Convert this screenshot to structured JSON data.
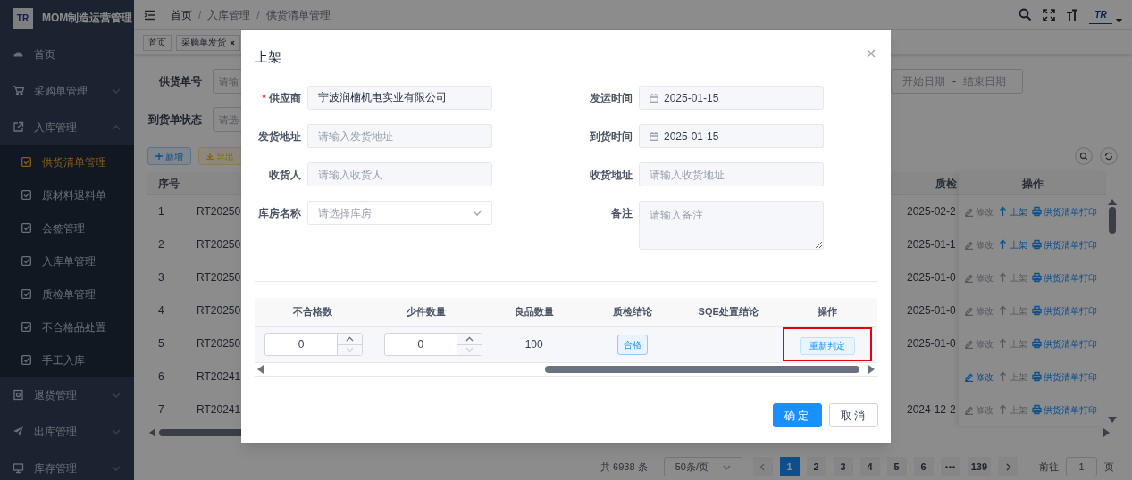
{
  "sidebar": {
    "logo_mark": "TR",
    "title": "MOM制造运营管理",
    "items": [
      {
        "label": "首页"
      },
      {
        "label": "采购单管理",
        "expanded": false
      },
      {
        "label": "入库管理",
        "expanded": true,
        "children": [
          {
            "label": "供货清单管理",
            "selected": true
          },
          {
            "label": "原材料退料单",
            "selected": false
          },
          {
            "label": "会签管理",
            "selected": false
          },
          {
            "label": "入库单管理",
            "selected": false
          },
          {
            "label": "质检单管理",
            "selected": false
          },
          {
            "label": "不合格品处置",
            "selected": false
          },
          {
            "label": "手工入库",
            "selected": false
          }
        ]
      },
      {
        "label": "退货管理",
        "expanded": false
      },
      {
        "label": "出库管理",
        "expanded": false
      },
      {
        "label": "库存管理",
        "expanded": false
      }
    ]
  },
  "header": {
    "breadcrumb": [
      {
        "label": "首页"
      },
      {
        "separator": "/",
        "label": "入库管理"
      },
      {
        "separator": "/",
        "label": "供货清单管理"
      }
    ],
    "avatar_mark": "TR"
  },
  "tags": [
    {
      "label": "首页",
      "closable": false
    },
    {
      "label": "采购单发货",
      "closable": true
    }
  ],
  "filters": [
    {
      "label": "供货单号",
      "placeholder": "请输"
    },
    {
      "label": "到货单状态",
      "placeholder": "请选"
    }
  ],
  "date_range": {
    "start_placeholder": "开始日期",
    "separator": "-",
    "end_placeholder": "结束日期"
  },
  "toolbar": [
    {
      "label": "新增",
      "kind": "primary"
    },
    {
      "label": "导出",
      "kind": "warning"
    }
  ],
  "table": {
    "columns": [
      "序号",
      "质检",
      "操作"
    ],
    "rows": [
      {
        "index": "1",
        "code": "RT20250",
        "column_3": "2025-02-2",
        "actions": [
          {
            "label": "修改",
            "disabled": true
          },
          {
            "label": "上架",
            "disabled": false
          },
          {
            "label": "供货清单打印",
            "disabled": false
          }
        ]
      },
      {
        "index": "2",
        "code": "RT20250",
        "column_3": "2025-01-1",
        "actions": [
          {
            "label": "修改",
            "disabled": true
          },
          {
            "label": "上架",
            "disabled": false
          },
          {
            "label": "供货清单打印",
            "disabled": false
          }
        ]
      },
      {
        "index": "3",
        "code": "RT20250",
        "column_3": "2025-01-0",
        "actions": [
          {
            "label": "修改",
            "disabled": true
          },
          {
            "label": "上架",
            "disabled": true
          },
          {
            "label": "供货清单打印",
            "disabled": false
          }
        ]
      },
      {
        "index": "4",
        "code": "RT20250",
        "column_3": "2025-01-0",
        "actions": [
          {
            "label": "修改",
            "disabled": true
          },
          {
            "label": "上架",
            "disabled": true
          },
          {
            "label": "供货清单打印",
            "disabled": false
          }
        ]
      },
      {
        "index": "5",
        "code": "RT20250",
        "column_3": "2025-01-0",
        "actions": [
          {
            "label": "修改",
            "disabled": true
          },
          {
            "label": "上架",
            "disabled": true
          },
          {
            "label": "供货清单打印",
            "disabled": false
          }
        ]
      },
      {
        "index": "6",
        "code": "RT20241",
        "actions": [
          {
            "label": "修改",
            "disabled": false
          },
          {
            "label": "上架",
            "disabled": true
          },
          {
            "label": "供货清单打印",
            "disabled": false
          }
        ]
      },
      {
        "index": "7",
        "code": "RT20241",
        "column_3": "2024-12-2",
        "actions": [
          {
            "label": "修改",
            "disabled": true
          },
          {
            "label": "上架",
            "disabled": true
          },
          {
            "label": "供货清单打印",
            "disabled": false
          }
        ]
      }
    ]
  },
  "pagination": {
    "total": "共 6938 条",
    "page_size": "50条/页",
    "pages": [
      {
        "label": "1",
        "selected": true
      },
      {
        "label": "2",
        "selected": false
      },
      {
        "label": "3",
        "selected": false
      },
      {
        "label": "4",
        "selected": false
      },
      {
        "label": "5",
        "selected": false
      },
      {
        "label": "6",
        "selected": false
      },
      {
        "kind": "more"
      },
      {
        "label": "139",
        "selected": false
      }
    ],
    "goto_label": "前往",
    "goto_value": "1",
    "goto_suffix": "页"
  },
  "dialog": {
    "title": "上架",
    "required_mark": "*",
    "fields": [
      {
        "label": "供应商",
        "required": true,
        "kind": "input",
        "value": "宁波润楠机电实业有限公司"
      },
      {
        "label": "发运时间",
        "required": false,
        "kind": "date",
        "value": "2025-01-15"
      },
      {
        "label": "发货地址",
        "required": false,
        "kind": "input",
        "placeholder": "请输入发货地址"
      },
      {
        "label": "到货时间",
        "required": false,
        "kind": "date",
        "value": "2025-01-15"
      },
      {
        "label": "收货人",
        "required": false,
        "kind": "input",
        "placeholder": "请输入收货人"
      },
      {
        "label": "收货地址",
        "required": false,
        "kind": "input",
        "placeholder": "请输入收货地址"
      },
      {
        "label": "库房名称",
        "required": false,
        "kind": "select",
        "placeholder": "请选择库房"
      },
      {
        "label": "备注",
        "required": false,
        "kind": "textarea",
        "placeholder": "请输入备注"
      }
    ],
    "table": {
      "columns": [
        "不合格数",
        "少件数量",
        "良品数量",
        "质检结论",
        "SQE处置结论",
        "操作"
      ],
      "rows": [
        {
          "defect_qty": "0",
          "missing_qty": "0",
          "good_qty": "100",
          "result": "合格",
          "action": "重新判定",
          "highlighted": true
        }
      ]
    },
    "buttons": [
      {
        "label": "确定",
        "kind": "primary"
      },
      {
        "label": "取消",
        "kind": "default"
      }
    ]
  }
}
